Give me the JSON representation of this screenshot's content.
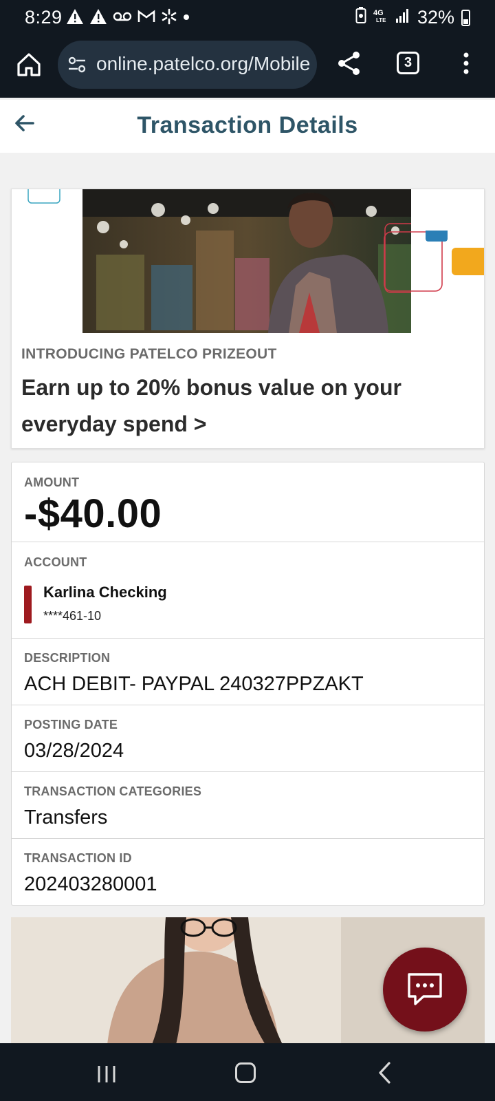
{
  "status_bar": {
    "time": "8:29",
    "network": "4G LTE",
    "battery": "32%"
  },
  "browser": {
    "url": "online.patelco.org/Mobile",
    "tab_count": "3"
  },
  "header": {
    "title": "Transaction Details"
  },
  "promo": {
    "eyebrow": "INTRODUCING PATELCO PRIZEOUT",
    "headline": "Earn up to 20% bonus value on your everyday spend >"
  },
  "transaction": {
    "amount_label": "AMOUNT",
    "amount": "-$40.00",
    "account_label": "ACCOUNT",
    "account_name": "Karlina Checking",
    "account_number": "****461-10",
    "description_label": "DESCRIPTION",
    "description": "ACH DEBIT- PAYPAL 240327PPZAKT",
    "posting_date_label": "POSTING DATE",
    "posting_date": "03/28/2024",
    "categories_label": "TRANSACTION CATEGORIES",
    "categories": "Transfers",
    "id_label": "TRANSACTION ID",
    "id": "202403280001"
  },
  "colors": {
    "brand_dark": "#2e5567",
    "account_marker": "#9e1a1f",
    "chat_button": "#74101a",
    "system_bar": "#111820"
  },
  "icons": {
    "browser": [
      "home-icon",
      "site-settings-icon",
      "share-icon",
      "tabs-icon",
      "more-vert-icon"
    ],
    "app": [
      "back-arrow-icon",
      "chat-icon"
    ],
    "nav": [
      "recents-icon",
      "home-nav-icon",
      "back-nav-icon"
    ]
  }
}
